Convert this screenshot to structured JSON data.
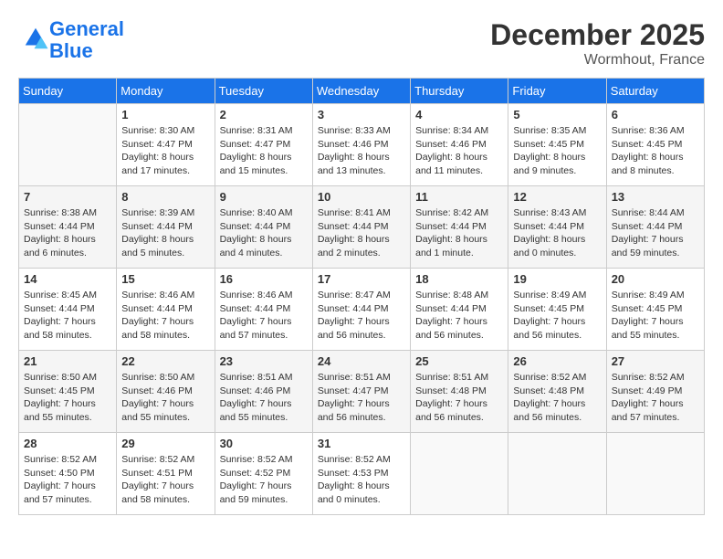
{
  "logo": {
    "line1": "General",
    "line2": "Blue"
  },
  "title": "December 2025",
  "location": "Wormhout, France",
  "days_of_week": [
    "Sunday",
    "Monday",
    "Tuesday",
    "Wednesday",
    "Thursday",
    "Friday",
    "Saturday"
  ],
  "weeks": [
    [
      {
        "day": "",
        "info": ""
      },
      {
        "day": "1",
        "info": "Sunrise: 8:30 AM\nSunset: 4:47 PM\nDaylight: 8 hours\nand 17 minutes."
      },
      {
        "day": "2",
        "info": "Sunrise: 8:31 AM\nSunset: 4:47 PM\nDaylight: 8 hours\nand 15 minutes."
      },
      {
        "day": "3",
        "info": "Sunrise: 8:33 AM\nSunset: 4:46 PM\nDaylight: 8 hours\nand 13 minutes."
      },
      {
        "day": "4",
        "info": "Sunrise: 8:34 AM\nSunset: 4:46 PM\nDaylight: 8 hours\nand 11 minutes."
      },
      {
        "day": "5",
        "info": "Sunrise: 8:35 AM\nSunset: 4:45 PM\nDaylight: 8 hours\nand 9 minutes."
      },
      {
        "day": "6",
        "info": "Sunrise: 8:36 AM\nSunset: 4:45 PM\nDaylight: 8 hours\nand 8 minutes."
      }
    ],
    [
      {
        "day": "7",
        "info": "Sunrise: 8:38 AM\nSunset: 4:44 PM\nDaylight: 8 hours\nand 6 minutes."
      },
      {
        "day": "8",
        "info": "Sunrise: 8:39 AM\nSunset: 4:44 PM\nDaylight: 8 hours\nand 5 minutes."
      },
      {
        "day": "9",
        "info": "Sunrise: 8:40 AM\nSunset: 4:44 PM\nDaylight: 8 hours\nand 4 minutes."
      },
      {
        "day": "10",
        "info": "Sunrise: 8:41 AM\nSunset: 4:44 PM\nDaylight: 8 hours\nand 2 minutes."
      },
      {
        "day": "11",
        "info": "Sunrise: 8:42 AM\nSunset: 4:44 PM\nDaylight: 8 hours\nand 1 minute."
      },
      {
        "day": "12",
        "info": "Sunrise: 8:43 AM\nSunset: 4:44 PM\nDaylight: 8 hours\nand 0 minutes."
      },
      {
        "day": "13",
        "info": "Sunrise: 8:44 AM\nSunset: 4:44 PM\nDaylight: 7 hours\nand 59 minutes."
      }
    ],
    [
      {
        "day": "14",
        "info": "Sunrise: 8:45 AM\nSunset: 4:44 PM\nDaylight: 7 hours\nand 58 minutes."
      },
      {
        "day": "15",
        "info": "Sunrise: 8:46 AM\nSunset: 4:44 PM\nDaylight: 7 hours\nand 58 minutes."
      },
      {
        "day": "16",
        "info": "Sunrise: 8:46 AM\nSunset: 4:44 PM\nDaylight: 7 hours\nand 57 minutes."
      },
      {
        "day": "17",
        "info": "Sunrise: 8:47 AM\nSunset: 4:44 PM\nDaylight: 7 hours\nand 56 minutes."
      },
      {
        "day": "18",
        "info": "Sunrise: 8:48 AM\nSunset: 4:44 PM\nDaylight: 7 hours\nand 56 minutes."
      },
      {
        "day": "19",
        "info": "Sunrise: 8:49 AM\nSunset: 4:45 PM\nDaylight: 7 hours\nand 56 minutes."
      },
      {
        "day": "20",
        "info": "Sunrise: 8:49 AM\nSunset: 4:45 PM\nDaylight: 7 hours\nand 55 minutes."
      }
    ],
    [
      {
        "day": "21",
        "info": "Sunrise: 8:50 AM\nSunset: 4:45 PM\nDaylight: 7 hours\nand 55 minutes."
      },
      {
        "day": "22",
        "info": "Sunrise: 8:50 AM\nSunset: 4:46 PM\nDaylight: 7 hours\nand 55 minutes."
      },
      {
        "day": "23",
        "info": "Sunrise: 8:51 AM\nSunset: 4:46 PM\nDaylight: 7 hours\nand 55 minutes."
      },
      {
        "day": "24",
        "info": "Sunrise: 8:51 AM\nSunset: 4:47 PM\nDaylight: 7 hours\nand 56 minutes."
      },
      {
        "day": "25",
        "info": "Sunrise: 8:51 AM\nSunset: 4:48 PM\nDaylight: 7 hours\nand 56 minutes."
      },
      {
        "day": "26",
        "info": "Sunrise: 8:52 AM\nSunset: 4:48 PM\nDaylight: 7 hours\nand 56 minutes."
      },
      {
        "day": "27",
        "info": "Sunrise: 8:52 AM\nSunset: 4:49 PM\nDaylight: 7 hours\nand 57 minutes."
      }
    ],
    [
      {
        "day": "28",
        "info": "Sunrise: 8:52 AM\nSunset: 4:50 PM\nDaylight: 7 hours\nand 57 minutes."
      },
      {
        "day": "29",
        "info": "Sunrise: 8:52 AM\nSunset: 4:51 PM\nDaylight: 7 hours\nand 58 minutes."
      },
      {
        "day": "30",
        "info": "Sunrise: 8:52 AM\nSunset: 4:52 PM\nDaylight: 7 hours\nand 59 minutes."
      },
      {
        "day": "31",
        "info": "Sunrise: 8:52 AM\nSunset: 4:53 PM\nDaylight: 8 hours\nand 0 minutes."
      },
      {
        "day": "",
        "info": ""
      },
      {
        "day": "",
        "info": ""
      },
      {
        "day": "",
        "info": ""
      }
    ]
  ]
}
